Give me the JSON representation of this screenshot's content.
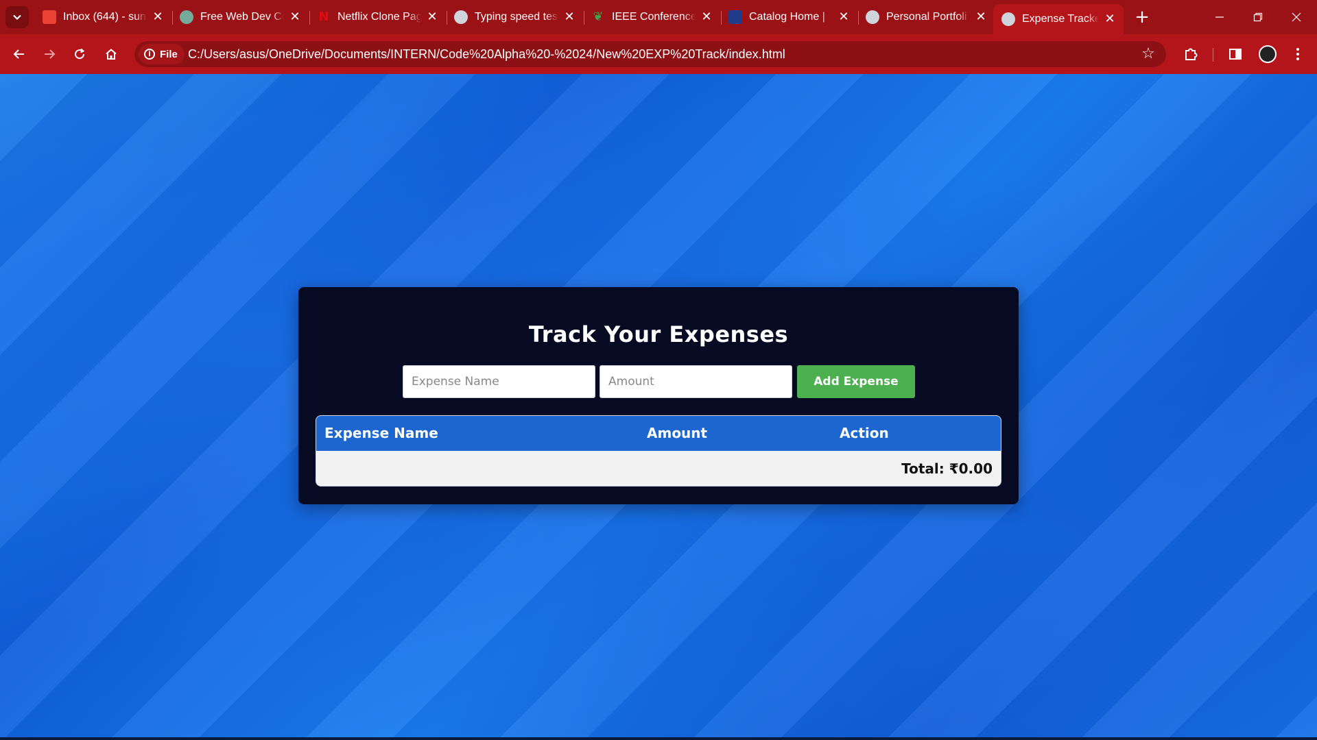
{
  "browser": {
    "tabs": [
      {
        "title": "Inbox (644) - sun",
        "favicon": "gmail-icon",
        "color": "#ea4335"
      },
      {
        "title": "Free Web Dev Co",
        "favicon": "chatgpt-icon",
        "color": "#74aa9c"
      },
      {
        "title": "Netflix Clone Pag",
        "favicon": "netflix-icon",
        "color": "#e50914"
      },
      {
        "title": "Typing speed tes",
        "favicon": "globe-icon",
        "color": "#cfd3da"
      },
      {
        "title": "IEEE Conference",
        "favicon": "leaf-icon",
        "color": "#3fa34d"
      },
      {
        "title": "Catalog Home | ",
        "favicon": "catalog-icon",
        "color": "#1f3b8a"
      },
      {
        "title": "Personal Portfoli",
        "favicon": "globe-icon",
        "color": "#cfd3da"
      },
      {
        "title": "Expense Tracker",
        "favicon": "globe-icon",
        "color": "#cfd3da",
        "active": true
      }
    ],
    "address": {
      "scheme_chip": "File",
      "url": "C:/Users/asus/OneDrive/Documents/INTERN/Code%20Alpha%20-%2024/New%20EXP%20Track/index.html"
    }
  },
  "app": {
    "title": "Track Your Expenses",
    "name_placeholder": "Expense Name",
    "amount_placeholder": "Amount",
    "add_button": "Add Expense",
    "columns": [
      "Expense Name",
      "Amount",
      "Action"
    ],
    "rows": [],
    "total_label": "Total: ₹0.00"
  },
  "colors": {
    "browser_frame": "#b4151a",
    "card_background": "#060a22",
    "table_header": "#1e66cf",
    "add_button": "#4caf50"
  }
}
